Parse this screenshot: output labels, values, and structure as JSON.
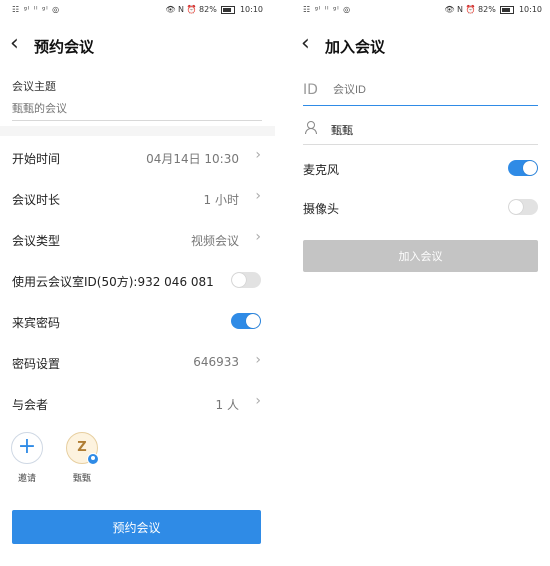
{
  "left": {
    "status": {
      "left_icons": "☷ ᵍˡ ˡˡ ᵍˡ ◎",
      "right_text": "👁 N ⏰ 82%",
      "time": "10:10"
    },
    "title": "预约会议",
    "subject": {
      "label": "会议主题",
      "placeholder": "甄甄的会议"
    },
    "rows": [
      {
        "label": "开始时间",
        "value": "04月14日 10:30"
      },
      {
        "label": "会议时长",
        "value": "1 小时"
      },
      {
        "label": "会议类型",
        "value": "视频会议"
      },
      {
        "label": "使用云会议室ID(50方):932 046 081",
        "toggle": false
      },
      {
        "label": "来宾密码",
        "toggle": true
      },
      {
        "label": "密码设置",
        "value": "646933"
      },
      {
        "label": "与会者",
        "value": "1 人"
      }
    ],
    "participants": [
      {
        "label": "邀请",
        "icon": "plus-icon"
      },
      {
        "label": "甄甄",
        "icon": "user-avatar"
      }
    ],
    "submit_label": "预约会议",
    "accent": "#2f8be6"
  },
  "right": {
    "status": {
      "left_icons": "☷ ᵍˡ ˡˡ ᵍˡ ◎",
      "right_text": "👁 N ⏰ 82%",
      "time": "10:10"
    },
    "title": "加入会议",
    "id_field": {
      "prefix": "ID",
      "placeholder": "会议ID"
    },
    "name_field": {
      "value": "甄甄"
    },
    "mic": {
      "label": "麦克风",
      "on": true
    },
    "camera": {
      "label": "摄像头",
      "on": false
    },
    "join_label": "加入会议"
  }
}
